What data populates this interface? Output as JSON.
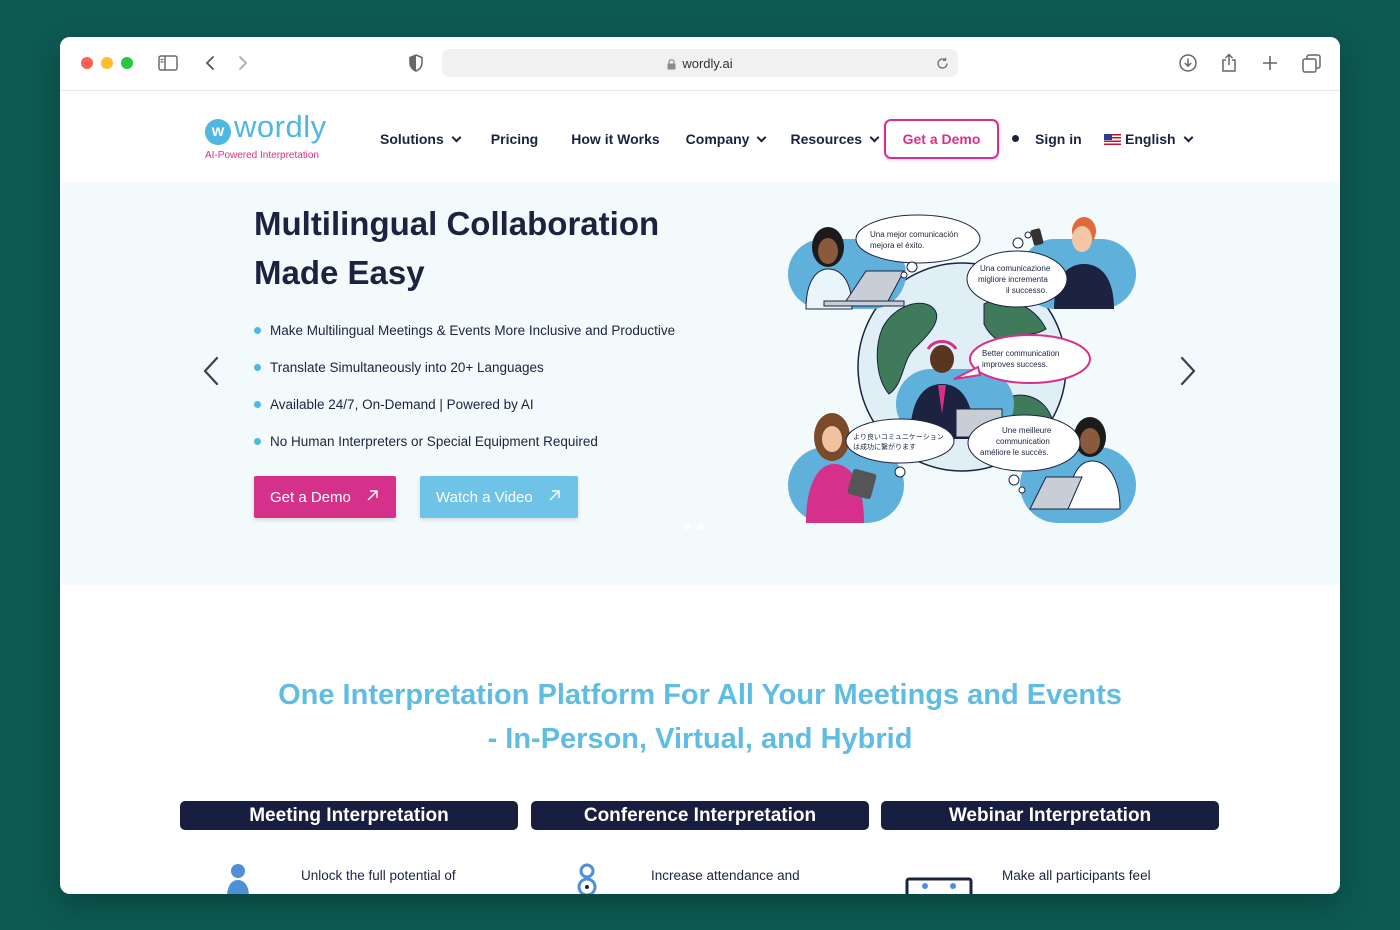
{
  "browser": {
    "url": "wordly.ai"
  },
  "header": {
    "logo_mark": "w",
    "logo_text": "wordly",
    "logo_tagline": "AI-Powered Interpretation",
    "nav": [
      {
        "label": "Solutions",
        "has_dropdown": true
      },
      {
        "label": "Pricing",
        "has_dropdown": false
      },
      {
        "label": "How it Works",
        "has_dropdown": false
      },
      {
        "label": "Company",
        "has_dropdown": true
      },
      {
        "label": "Resources",
        "has_dropdown": true
      }
    ],
    "cta": "Get a Demo",
    "sign_in": "Sign in",
    "language": "English"
  },
  "hero": {
    "title_line1": "Multilingual Collaboration",
    "title_line2": "Made Easy",
    "bullets": [
      "Make Multilingual Meetings & Events More Inclusive and Productive",
      "Translate Simultaneously into 20+ Languages",
      "Available 24/7, On-Demand | Powered by AI",
      "No Human Interpreters or Special Equipment Required"
    ],
    "primary_button": "Get a Demo",
    "secondary_button": "Watch a Video",
    "bubbles": {
      "spanish_1": "Una mejor comunicación",
      "spanish_2": "mejora el éxito.",
      "italian_1": "Una comunicazione",
      "italian_2": "migliore incrementa",
      "italian_3": "il successo.",
      "english_1": "Better communication",
      "english_2": "improves success.",
      "japanese_1": "より良いコミュニケーション",
      "japanese_2": "は成功に繋がります",
      "french_1": "Une meilleure",
      "french_2": "communication",
      "french_3": "améliore le succès."
    }
  },
  "section": {
    "title_line1": "One Interpretation Platform For All Your Meetings and Events",
    "title_line2": "- In-Person, Virtual, and Hybrid",
    "cards": [
      {
        "label": "Meeting Interpretation",
        "text": "Unlock the full potential of",
        "icon": "person-icon"
      },
      {
        "label": "Conference Interpretation",
        "text": "Increase attendance and",
        "icon": "attendee-icon"
      },
      {
        "label": "Webinar Interpretation",
        "text": "Make all participants feel",
        "icon": "screen-participants-icon"
      }
    ]
  },
  "colors": {
    "brand_blue": "#4fb8e0",
    "brand_pink": "#d6318a",
    "navy": "#1b2340",
    "pill_navy": "#171e3f",
    "hero_bg": "#f3fafb"
  }
}
